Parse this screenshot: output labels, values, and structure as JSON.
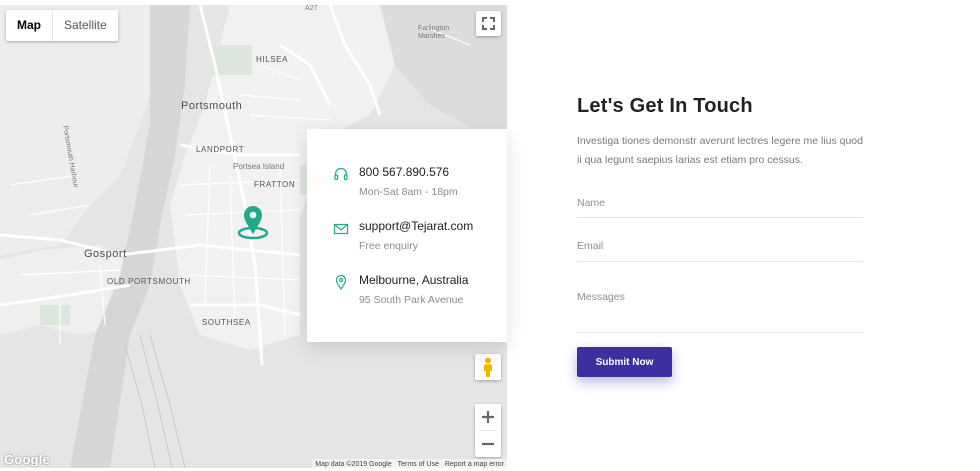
{
  "map": {
    "type_control": {
      "map_label": "Map",
      "satellite_label": "Satellite"
    },
    "labels": {
      "hilsea": "HILSEA",
      "portsmouth": "Portsmouth",
      "landport": "LANDPORT",
      "fratton": "FRATTON",
      "gosport": "Gosport",
      "old_portsmouth": "OLD PORTSMOUTH",
      "southsea": "SOUTHSEA",
      "farlington_marshes": "Farlington Marshes",
      "portsmouth_harbour": "Portsmouth Harbour",
      "portsea_island": "Portsea Island",
      "a27": "A27"
    },
    "google_label": "Google",
    "attribution": {
      "data": "Map data ©2019 Google",
      "terms": "Terms of Use",
      "report": "Report a map error"
    },
    "icons": [
      "fullscreen-icon",
      "pegman-icon",
      "zoom-in-icon",
      "zoom-out-icon",
      "map-pin-icon"
    ],
    "pin_color": "#1fab89"
  },
  "contact_card": {
    "phone": "800 567.890.576",
    "phone_sub": "Mon-Sat 8am - 18pm",
    "email": "support@Tejarat.com",
    "email_sub": "Free enquiry",
    "location": "Melbourne, Australia",
    "location_sub": "95 South Park Avenue",
    "accent_color": "#1fab89"
  },
  "form": {
    "title": "Let's Get In Touch",
    "description": "Investiga tiones demonstr averunt lectres legere me lius quod ii qua legunt saepius larias est etiam pro cessus.",
    "name_placeholder": "Name",
    "email_placeholder": "Email",
    "messages_placeholder": "Messages",
    "submit_label": "Submit Now",
    "button_color": "#3c2fa0"
  }
}
